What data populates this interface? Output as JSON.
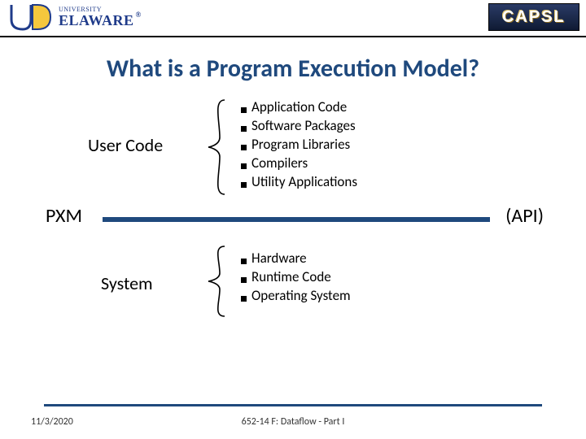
{
  "logo": {
    "ud_top": "UNIVERSITY",
    "ud_bot": "ELAWARE",
    "capsl": "CAPSL"
  },
  "title": "What is a Program Execution Model?",
  "labels": {
    "user_code": "User Code",
    "system": "System",
    "pxm": "PXM",
    "api": "(API)"
  },
  "user_code_items": [
    "Application Code",
    "Software Packages",
    "Program Libraries",
    "Compilers",
    "Utility Applications"
  ],
  "system_items": [
    "Hardware",
    "Runtime Code",
    "Operating System"
  ],
  "footer": {
    "date": "11/3/2020",
    "course": "652-14 F: Dataflow - Part I"
  }
}
